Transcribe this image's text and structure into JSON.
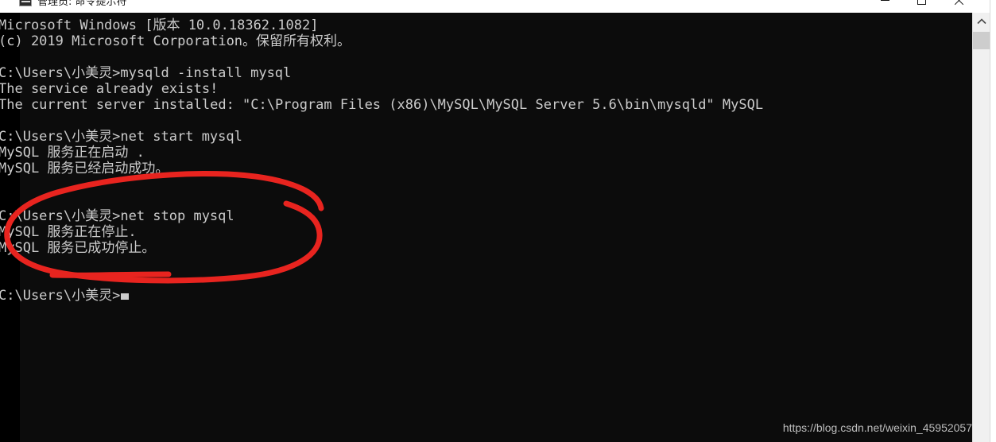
{
  "window": {
    "title": "管理员: 命令提示符",
    "icon": "console-icon",
    "buttons": {
      "minimize": "–",
      "maximize": "□",
      "close": "✕"
    }
  },
  "terminal": {
    "prompt_user_path": "C:\\Users\\小美灵>",
    "cursor": "block-cursor",
    "lines": [
      {
        "id": "banner-version",
        "text": "Microsoft Windows [版本 10.0.18362.1082]"
      },
      {
        "id": "banner-copyright",
        "text": "(c) 2019 Microsoft Corporation。保留所有权利。"
      },
      {
        "id": "blank-1",
        "text": ""
      },
      {
        "id": "cmd-mysqld-install",
        "text": "C:\\Users\\小美灵>mysqld -install mysql"
      },
      {
        "id": "out-service-exists",
        "text": "The service already exists!"
      },
      {
        "id": "out-current-server",
        "text": "The current server installed: \"C:\\Program Files (x86)\\MySQL\\MySQL Server 5.6\\bin\\mysqld\" MySQL"
      },
      {
        "id": "blank-2",
        "text": ""
      },
      {
        "id": "cmd-net-start",
        "text": "C:\\Users\\小美灵>net start mysql"
      },
      {
        "id": "out-start-starting",
        "text": "MySQL 服务正在启动 ."
      },
      {
        "id": "out-start-success",
        "text": "MySQL 服务已经启动成功。"
      },
      {
        "id": "blank-3",
        "text": ""
      },
      {
        "id": "blank-4",
        "text": ""
      },
      {
        "id": "cmd-net-stop",
        "text": "C:\\Users\\小美灵>net stop mysql"
      },
      {
        "id": "out-stop-stopping",
        "text": "MySQL 服务正在停止."
      },
      {
        "id": "out-stop-success",
        "text": "MySQL 服务已成功停止。"
      },
      {
        "id": "blank-5",
        "text": ""
      },
      {
        "id": "blank-6",
        "text": ""
      },
      {
        "id": "prompt-final",
        "text": "C:\\Users\\小美灵>"
      }
    ]
  },
  "annotation": {
    "type": "hand-drawn-ellipse",
    "color": "#e8241f",
    "stroke_width": 7,
    "targets": "net stop mysql 命令及输出"
  },
  "watermark": {
    "text": "https://blog.csdn.net/weixin_45952057"
  },
  "scrollbar": {
    "up_arrow": "chevron-up-icon",
    "thumb_position_percent": 2
  },
  "colors": {
    "console_background": "#0c0c0c",
    "console_text": "#cccccc",
    "annotation_red": "#e8241f",
    "titlebar_background": "#ffffff",
    "watermark_text": "#bdbdbd"
  }
}
